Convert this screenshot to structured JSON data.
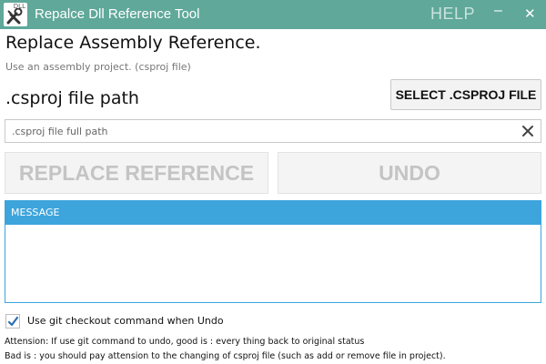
{
  "titlebar": {
    "icon": "dll-tools-icon",
    "icon_text": "DLL",
    "title": "Repalce Dll Reference Tool",
    "help": "HELP",
    "minimize": "–",
    "close": "✕",
    "background": "#5fa89a"
  },
  "main": {
    "heading": "Replace Assembly Reference.",
    "subheading": "Use an assembly project. (csproj file)",
    "path_label": ".csproj file path",
    "select_button": "SELECT .CSPROJ FILE",
    "path_input": {
      "value": "",
      "placeholder": ".csproj file full path"
    },
    "replace_button": "REPLACE REFERENCE",
    "undo_button": "UNDO"
  },
  "message": {
    "header": "MESSAGE",
    "body": "",
    "accent": "#3da4dc"
  },
  "options": {
    "git_checkout_checked": true,
    "git_checkout_label": "Use git checkout command when Undo"
  },
  "notes": {
    "line1": "Attension: If use git command to undo, good is : every thing back to original status",
    "line2": "Bad is : you should pay attension to the changing of csproj file (such as add or remove file in project)."
  }
}
